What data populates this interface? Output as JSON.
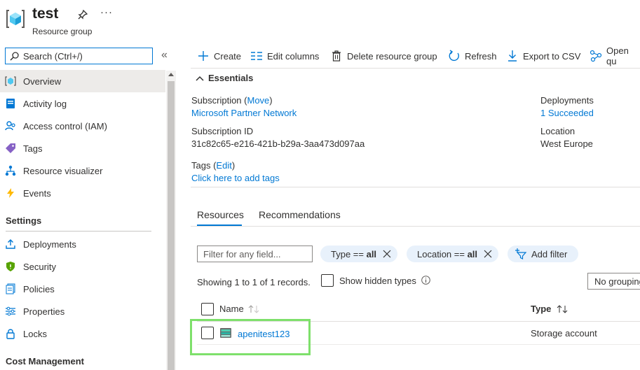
{
  "header": {
    "title": "test",
    "subtitle": "Resource group",
    "more": "···"
  },
  "sidebar": {
    "search_placeholder": "Search (Ctrl+/)",
    "collapse": "«",
    "items": [
      {
        "label": "Overview",
        "icon": "overview-icon"
      },
      {
        "label": "Activity log",
        "icon": "activity-log-icon"
      },
      {
        "label": "Access control (IAM)",
        "icon": "iam-icon"
      },
      {
        "label": "Tags",
        "icon": "tag-icon"
      },
      {
        "label": "Resource visualizer",
        "icon": "visualizer-icon"
      },
      {
        "label": "Events",
        "icon": "events-icon"
      }
    ],
    "settings_header": "Settings",
    "settings_items": [
      {
        "label": "Deployments",
        "icon": "deployments-icon"
      },
      {
        "label": "Security",
        "icon": "shield-icon"
      },
      {
        "label": "Policies",
        "icon": "policies-icon"
      },
      {
        "label": "Properties",
        "icon": "properties-icon"
      },
      {
        "label": "Locks",
        "icon": "lock-icon"
      }
    ],
    "cost_header": "Cost Management"
  },
  "toolbar": {
    "create": "Create",
    "edit_columns": "Edit columns",
    "delete": "Delete resource group",
    "refresh": "Refresh",
    "export": "Export to CSV",
    "open_query": "Open qu"
  },
  "essentials": {
    "header": "Essentials",
    "subscription_label": "Subscription",
    "move_link": "Move",
    "subscription_value": "Microsoft Partner Network",
    "subscription_id_label": "Subscription ID",
    "subscription_id_value": "31c82c65-e216-421b-b29a-3aa473d097aa",
    "tags_label": "Tags",
    "edit_link": "Edit",
    "tags_value": "Click here to add tags",
    "deployments_label": "Deployments",
    "deployments_value": "1 Succeeded",
    "location_label": "Location",
    "location_value": "West Europe"
  },
  "tabs": [
    {
      "label": "Resources",
      "active": true
    },
    {
      "label": "Recommendations",
      "active": false
    }
  ],
  "filters": {
    "filter_placeholder": "Filter for any field...",
    "type_prefix": "Type == ",
    "type_value": "all",
    "location_prefix": "Location == ",
    "location_value": "all",
    "add_filter": "Add filter",
    "records_text": "Showing 1 to 1 of 1 records.",
    "show_hidden": "Show hidden types",
    "grouping": "No grouping"
  },
  "grid": {
    "columns": {
      "name": "Name",
      "type": "Type"
    },
    "rows": [
      {
        "name": "apenitest123",
        "type": "Storage account"
      }
    ]
  },
  "colors": {
    "accent": "#0078d4",
    "highlight": "#7ee06b",
    "pill_bg": "#e8f1fb"
  }
}
